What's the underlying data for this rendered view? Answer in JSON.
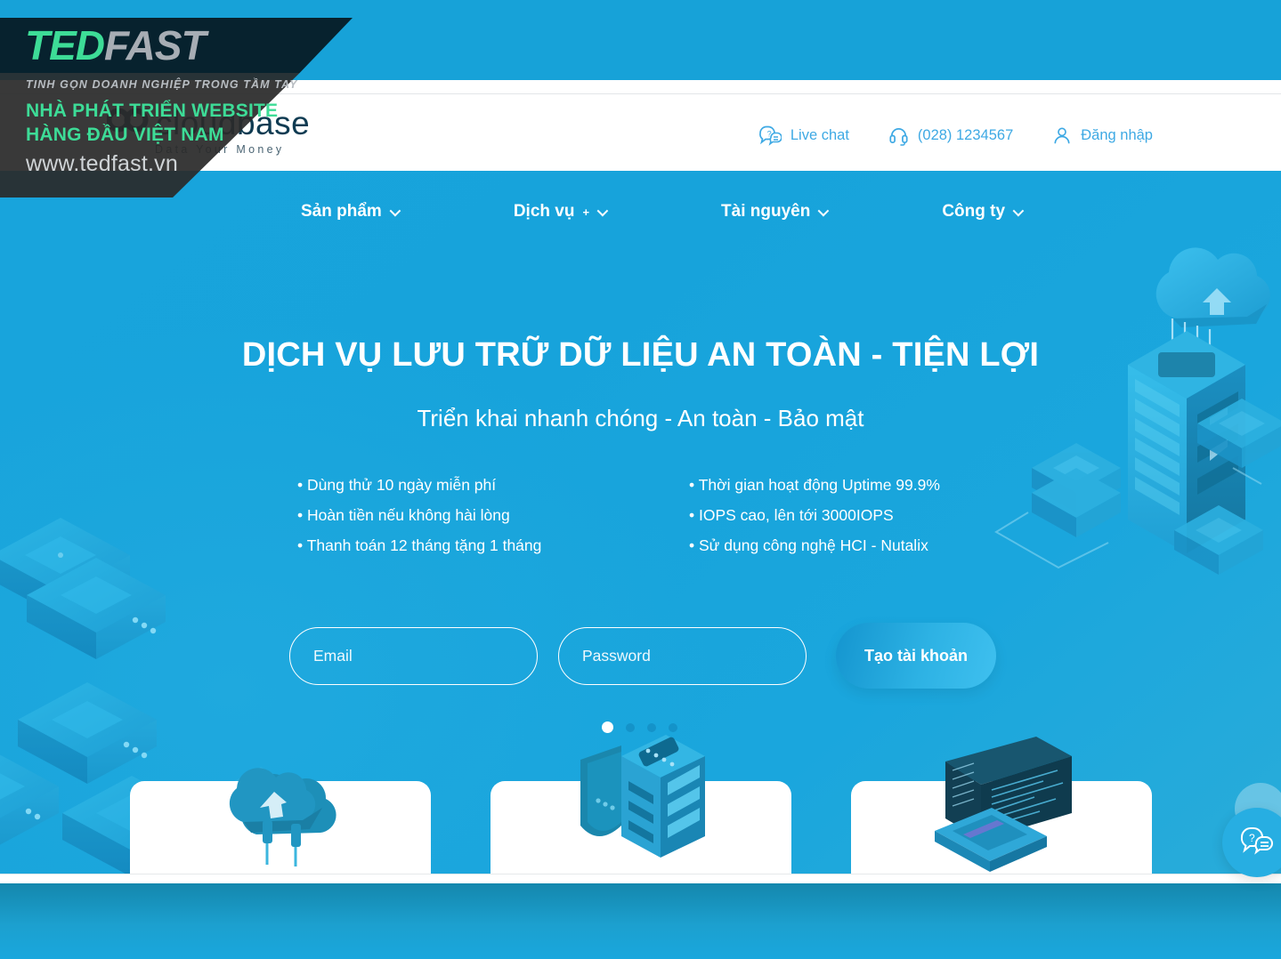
{
  "brand": {
    "name": "cloudbase",
    "tagline": "Data Your Money",
    "rings_icon": "double-ring-icon"
  },
  "header": {
    "utils": [
      {
        "icon": "chat-question-icon",
        "label": "Live chat"
      },
      {
        "icon": "headset-icon",
        "label": "(028) 1234567"
      },
      {
        "icon": "user-icon",
        "label": "Đăng nhập"
      }
    ]
  },
  "nav": {
    "items": [
      {
        "label": "Sản phẩm",
        "sup": "",
        "chevron": "chevron-down-icon"
      },
      {
        "label": "Dịch vụ",
        "sup": "+",
        "chevron": "chevron-down-icon"
      },
      {
        "label": "Tài nguyên",
        "sup": "",
        "chevron": "chevron-down-icon"
      },
      {
        "label": "Công ty",
        "sup": "",
        "chevron": "chevron-down-icon"
      }
    ]
  },
  "hero": {
    "title": "DỊCH VỤ LƯU TRỮ DỮ LIỆU AN TOÀN - TIỆN LỢI",
    "subtitle": "Triển khai nhanh chóng - An toàn - Bảo mật",
    "benefits_left": [
      "Dùng thử 10 ngày miễn phí",
      "Hoàn tiền nếu không hài lòng",
      "Thanh toán 12 tháng tặng 1 tháng"
    ],
    "benefits_right": [
      "Thời gian hoạt động Uptime 99.9%",
      "IOPS cao, lên tới 3000IOPS",
      "Sử dụng công nghệ HCI - Nutalix"
    ]
  },
  "signup": {
    "email_placeholder": "Email",
    "email_value": "",
    "password_placeholder": "Password",
    "password_value": "",
    "submit_label": "Tạo tài khoản"
  },
  "carousel": {
    "total": 4,
    "active_index": 0
  },
  "cards": [
    {
      "illustration": "cloud-upload-icon"
    },
    {
      "illustration": "server-shield-icon"
    },
    {
      "illustration": "monitor-code-icon"
    }
  ],
  "chat_widget": {
    "icon": "chat-question-icon"
  },
  "overlay_banner": {
    "logo_ted": "TED",
    "logo_fast": "FAST",
    "slogan": "TINH GỌN DOANH NGHIỆP TRONG TẦM TAY",
    "line1": "NHÀ PHÁT TRIỂN WEBSITE",
    "line2": "HÀNG ĐẦU VIỆT NAM",
    "url": "www.tedfast.vn"
  },
  "colors": {
    "hero_bg": "#17a3db",
    "accent": "#3ea9e4",
    "brand_dark": "#0f3b52",
    "overlay_green": "#3ddc97",
    "overlay_dark": "#07222e",
    "bottom_bar": "#1487ad"
  }
}
